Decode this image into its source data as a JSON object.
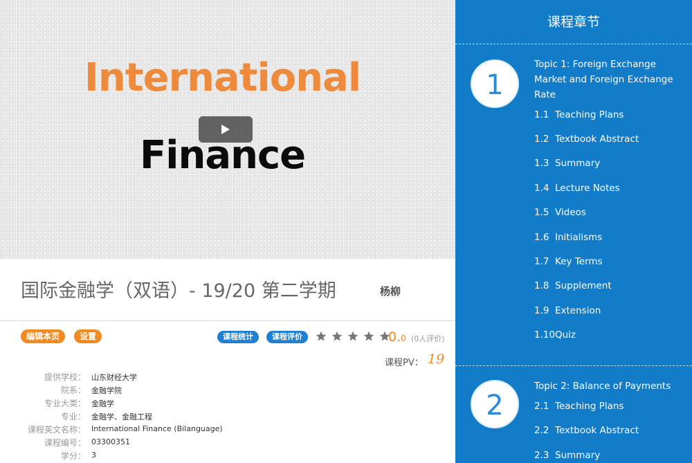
{
  "video": {
    "cover_line1": "International",
    "cover_line2": "Finance",
    "play_icon": "play-icon"
  },
  "course": {
    "title": "国际金融学（双语）- 19/20 第二学期",
    "teacher": "杨柳",
    "actions": {
      "edit_label": "编辑本页",
      "settings_label": "设置",
      "stats_label": "课程统计",
      "review_label": "课程评价"
    },
    "rating": {
      "stars_total": 5,
      "stars_filled": 0,
      "score_main": "0.",
      "score_decimal": "0",
      "review_count": "(0人评价)"
    },
    "pv_label": "课程PV：",
    "pv_value": "19",
    "info": [
      {
        "label": "提供学校：",
        "value": "山东财经大学"
      },
      {
        "label": "院系：",
        "value": "金融学院"
      },
      {
        "label": "专业大类：",
        "value": "金融学"
      },
      {
        "label": "专业：",
        "value": "金融学、金融工程"
      },
      {
        "label": "课程英文名称：",
        "value": "International Finance (Bilanguage)"
      },
      {
        "label": "课程编号：",
        "value": "03300351"
      },
      {
        "label": "学分：",
        "value": "3"
      }
    ]
  },
  "panel": {
    "title": "课程章节",
    "topics": [
      {
        "number": "1",
        "title": "Topic 1: Foreign Exchange Market and Foreign Exchange Rate",
        "chapters": [
          {
            "num": "1.1",
            "label": "Teaching Plans"
          },
          {
            "num": "1.2",
            "label": "Textbook Abstract"
          },
          {
            "num": "1.3",
            "label": "Summary"
          },
          {
            "num": "1.4",
            "label": "Lecture Notes"
          },
          {
            "num": "1.5",
            "label": "Videos"
          },
          {
            "num": "1.6",
            "label": "Initialisms"
          },
          {
            "num": "1.7",
            "label": "Key Terms"
          },
          {
            "num": "1.8",
            "label": "Supplement"
          },
          {
            "num": "1.9",
            "label": "Extension"
          },
          {
            "num": "1.10",
            "label": "Quiz"
          }
        ]
      },
      {
        "number": "2",
        "title": "Topic 2: Balance of Payments",
        "chapters": [
          {
            "num": "2.1",
            "label": "Teaching Plans"
          },
          {
            "num": "2.2",
            "label": "Textbook Abstract"
          },
          {
            "num": "2.3",
            "label": "Summary"
          }
        ]
      }
    ]
  },
  "colors": {
    "accent_orange": "#f18a20",
    "accent_blue": "#1f7fd0",
    "panel_blue": "#137cc8",
    "cover_orange": "#ee8a3c"
  }
}
